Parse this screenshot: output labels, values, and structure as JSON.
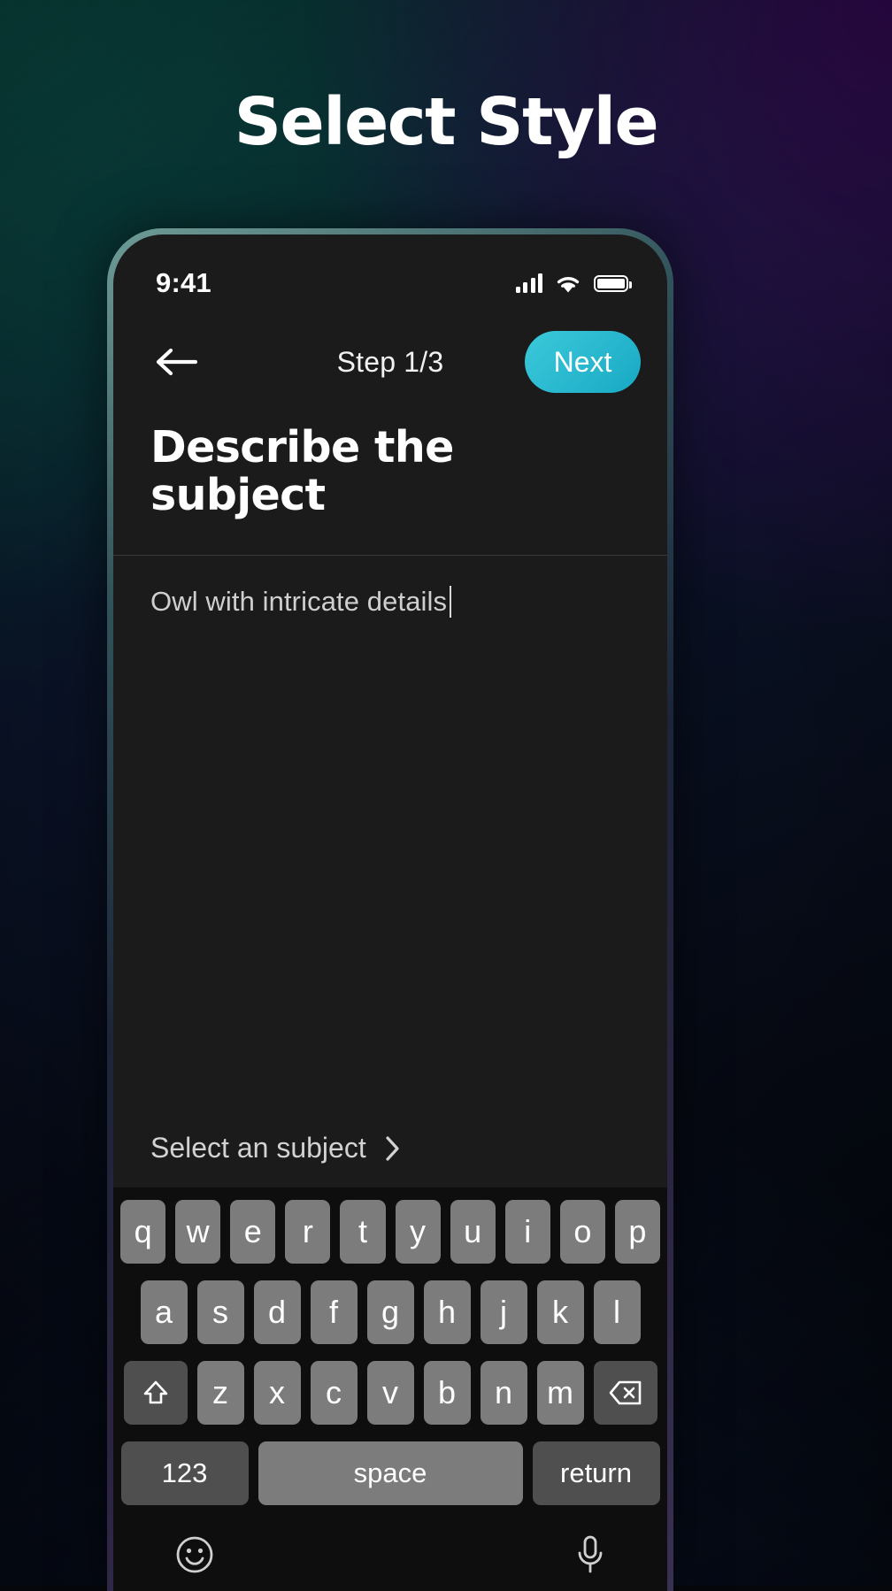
{
  "page": {
    "title": "Select Style",
    "background_accent_teal": "#0b5049",
    "background_accent_purple": "#3a0a5e"
  },
  "phone": {
    "status_bar": {
      "time": "9:41",
      "icons": [
        "signal-icon",
        "wifi-icon",
        "battery-icon"
      ]
    },
    "nav_bar": {
      "back_icon": "arrow-left-icon",
      "step_label": "Step 1/3",
      "next_label": "Next",
      "next_color": "#2bb8d4"
    },
    "screen": {
      "heading": "Describe the subject",
      "prompt_value": "Owl with intricate details",
      "prompt_placeholder": "Describe the subject",
      "select_subject_label": "Select an subject",
      "select_subject_chevron": "chevron-right-icon"
    },
    "keyboard": {
      "row1": [
        "q",
        "w",
        "e",
        "r",
        "t",
        "y",
        "u",
        "i",
        "o",
        "p"
      ],
      "row2": [
        "a",
        "s",
        "d",
        "f",
        "g",
        "h",
        "j",
        "k",
        "l"
      ],
      "row3_letters": [
        "z",
        "x",
        "c",
        "v",
        "b",
        "n",
        "m"
      ],
      "shift_icon": "shift-up-icon",
      "backspace_icon": "backspace-icon",
      "numbers_label": "123",
      "space_label": "space",
      "return_label": "return",
      "emoji_icon": "emoji-smiley-icon",
      "mic_icon": "microphone-icon"
    }
  }
}
